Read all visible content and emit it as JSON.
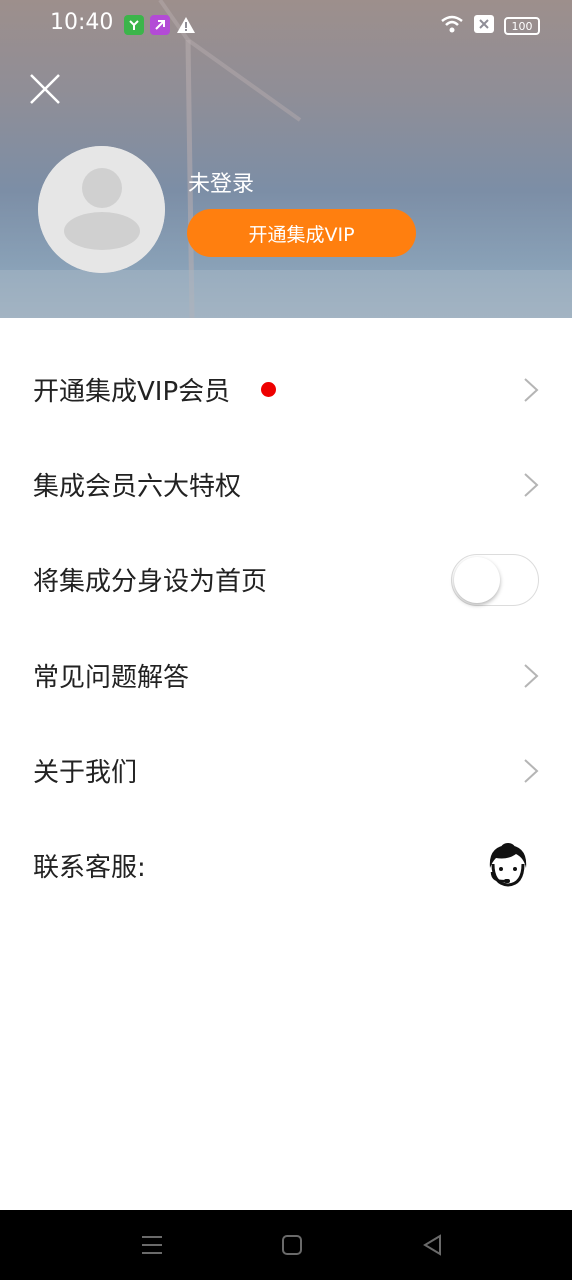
{
  "status_bar": {
    "time": "10:40",
    "battery": "100",
    "icons": [
      "app-green-icon",
      "app-purple-icon",
      "warning-icon",
      "wifi-icon",
      "sim-x-icon",
      "battery-icon"
    ]
  },
  "profile": {
    "login_status": "未登录",
    "vip_button_label": "开通集成VIP"
  },
  "menu": [
    {
      "label": "开通集成VIP会员",
      "badge": "red-dot",
      "trailing": "chevron-right-icon"
    },
    {
      "label": "集成会员六大特权",
      "trailing": "chevron-right-icon"
    },
    {
      "label": "将集成分身设为首页",
      "trailing": "toggle",
      "toggle_on": false
    },
    {
      "label": "常见问题解答",
      "trailing": "chevron-right-icon"
    },
    {
      "label": "关于我们",
      "trailing": "chevron-right-icon"
    },
    {
      "label": "联系客服:",
      "trailing": "customer-service-icon"
    }
  ],
  "nav_bar": [
    "menu-icon",
    "home-icon",
    "back-icon"
  ],
  "colors": {
    "accent": "#ff7f0f",
    "badge": "#ee0000",
    "text": "#222222",
    "nav_bg": "#000000"
  }
}
